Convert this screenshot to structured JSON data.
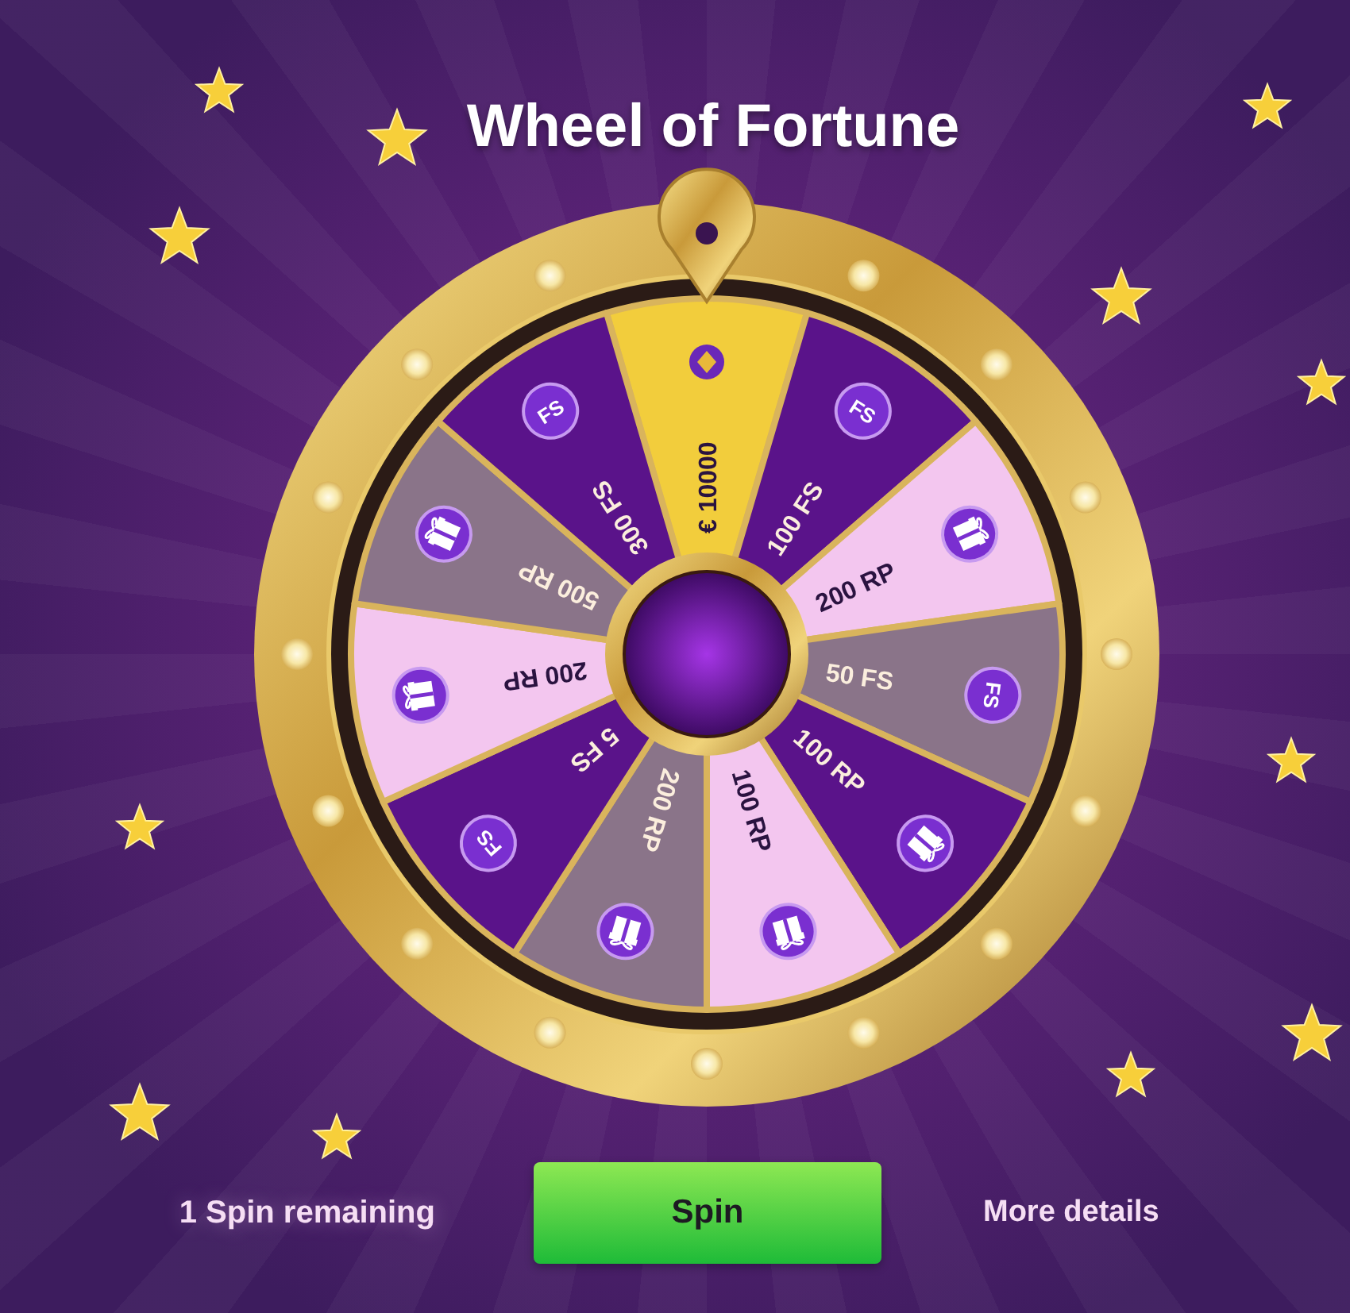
{
  "title": "Wheel of Fortune",
  "segments": [
    {
      "label": "€ 10000",
      "kind": "cash",
      "color": "#f2cd3c"
    },
    {
      "label": "100 FS",
      "kind": "fs",
      "badge": "FS",
      "color": "#5a138a"
    },
    {
      "label": "200 RP",
      "kind": "gift",
      "color": "#f3c6ef"
    },
    {
      "label": "50 FS",
      "kind": "fs",
      "badge": "FS",
      "color": "#8a7489"
    },
    {
      "label": "100 RP",
      "kind": "gift",
      "color": "#5a138a"
    },
    {
      "label": "100 RP",
      "kind": "gift",
      "color": "#f3c6ef"
    },
    {
      "label": "200 RP",
      "kind": "gift",
      "color": "#8a7489"
    },
    {
      "label": "5 FS",
      "kind": "fs",
      "badge": "FS",
      "color": "#5a138a"
    },
    {
      "label": "200 RP",
      "kind": "gift",
      "color": "#f3c6ef"
    },
    {
      "label": "500 RP",
      "kind": "gift",
      "color": "#8a7489"
    },
    {
      "label": "300 FS",
      "kind": "fs",
      "badge": "FS",
      "color": "#5a138a"
    }
  ],
  "spins_remaining": "1 Spin remaining",
  "spin_button": "Spin",
  "details_link": "More details"
}
